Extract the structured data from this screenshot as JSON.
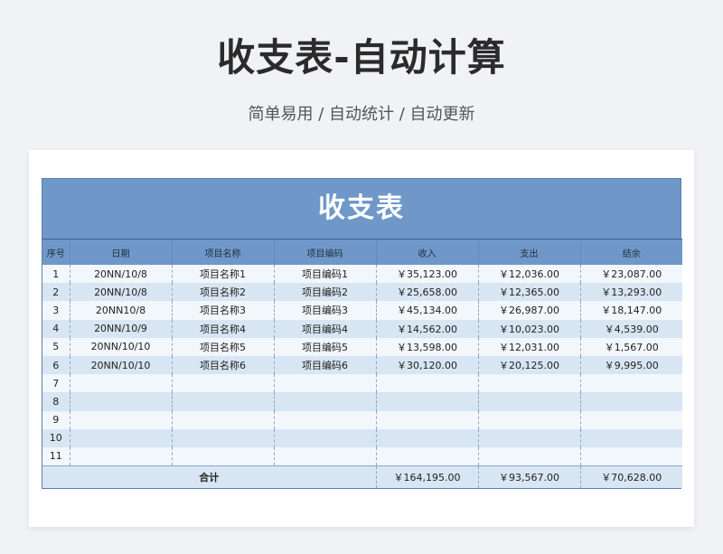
{
  "header": {
    "title": "收支表-自动计算",
    "subtitle": "简单易用 / 自动统计 / 自动更新"
  },
  "sheet": {
    "title": "收支表",
    "columns": [
      "序号",
      "日期",
      "项目名称",
      "项目编码",
      "收入",
      "支出",
      "结余"
    ],
    "rows": [
      [
        "1",
        "20NN/10/8",
        "项目名称1",
        "项目编码1",
        "￥35,123.00",
        "￥12,036.00",
        "￥23,087.00"
      ],
      [
        "2",
        "20NN/10/8",
        "项目名称2",
        "项目编码2",
        "￥25,658.00",
        "￥12,365.00",
        "￥13,293.00"
      ],
      [
        "3",
        "20NN10/8",
        "项目名称3",
        "项目编码3",
        "￥45,134.00",
        "￥26,987.00",
        "￥18,147.00"
      ],
      [
        "4",
        "20NN/10/9",
        "项目名称4",
        "项目编码4",
        "￥14,562.00",
        "￥10,023.00",
        "￥4,539.00"
      ],
      [
        "5",
        "20NN/10/10",
        "项目名称5",
        "项目编码5",
        "￥13,598.00",
        "￥12,031.00",
        "￥1,567.00"
      ],
      [
        "6",
        "20NN/10/10",
        "项目名称6",
        "项目编码6",
        "￥30,120.00",
        "￥20,125.00",
        "￥9,995.00"
      ],
      [
        "7",
        "",
        "",
        "",
        "",
        "",
        ""
      ],
      [
        "8",
        "",
        "",
        "",
        "",
        "",
        ""
      ],
      [
        "9",
        "",
        "",
        "",
        "",
        "",
        ""
      ],
      [
        "10",
        "",
        "",
        "",
        "",
        "",
        ""
      ],
      [
        "11",
        "",
        "",
        "",
        "",
        "",
        ""
      ]
    ],
    "total": {
      "label": "合计",
      "income": "￥164,195.00",
      "expense": "￥93,567.00",
      "balance": "￥70,628.00"
    }
  }
}
